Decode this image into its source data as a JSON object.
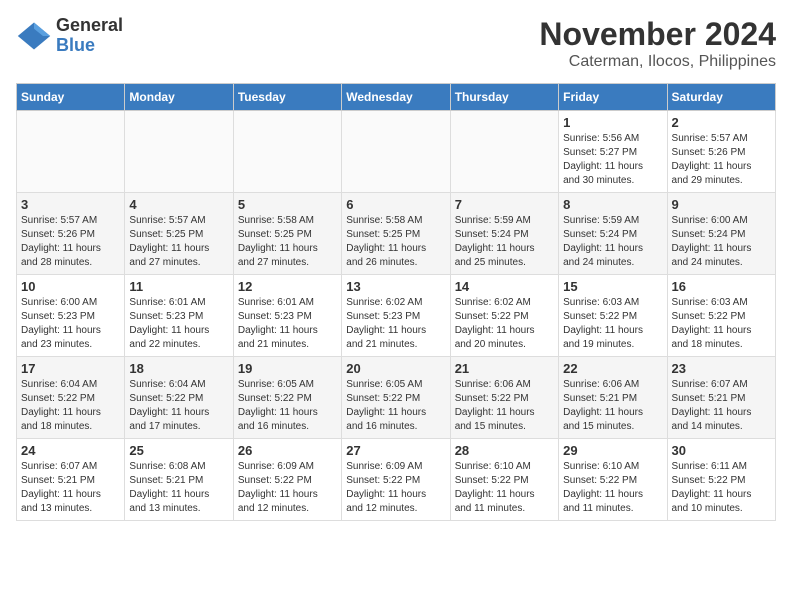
{
  "header": {
    "logo_line1": "General",
    "logo_line2": "Blue",
    "month_title": "November 2024",
    "location": "Caterman, Ilocos, Philippines"
  },
  "days_of_week": [
    "Sunday",
    "Monday",
    "Tuesday",
    "Wednesday",
    "Thursday",
    "Friday",
    "Saturday"
  ],
  "weeks": [
    [
      {
        "day": "",
        "info": ""
      },
      {
        "day": "",
        "info": ""
      },
      {
        "day": "",
        "info": ""
      },
      {
        "day": "",
        "info": ""
      },
      {
        "day": "",
        "info": ""
      },
      {
        "day": "1",
        "info": "Sunrise: 5:56 AM\nSunset: 5:27 PM\nDaylight: 11 hours\nand 30 minutes."
      },
      {
        "day": "2",
        "info": "Sunrise: 5:57 AM\nSunset: 5:26 PM\nDaylight: 11 hours\nand 29 minutes."
      }
    ],
    [
      {
        "day": "3",
        "info": "Sunrise: 5:57 AM\nSunset: 5:26 PM\nDaylight: 11 hours\nand 28 minutes."
      },
      {
        "day": "4",
        "info": "Sunrise: 5:57 AM\nSunset: 5:25 PM\nDaylight: 11 hours\nand 27 minutes."
      },
      {
        "day": "5",
        "info": "Sunrise: 5:58 AM\nSunset: 5:25 PM\nDaylight: 11 hours\nand 27 minutes."
      },
      {
        "day": "6",
        "info": "Sunrise: 5:58 AM\nSunset: 5:25 PM\nDaylight: 11 hours\nand 26 minutes."
      },
      {
        "day": "7",
        "info": "Sunrise: 5:59 AM\nSunset: 5:24 PM\nDaylight: 11 hours\nand 25 minutes."
      },
      {
        "day": "8",
        "info": "Sunrise: 5:59 AM\nSunset: 5:24 PM\nDaylight: 11 hours\nand 24 minutes."
      },
      {
        "day": "9",
        "info": "Sunrise: 6:00 AM\nSunset: 5:24 PM\nDaylight: 11 hours\nand 24 minutes."
      }
    ],
    [
      {
        "day": "10",
        "info": "Sunrise: 6:00 AM\nSunset: 5:23 PM\nDaylight: 11 hours\nand 23 minutes."
      },
      {
        "day": "11",
        "info": "Sunrise: 6:01 AM\nSunset: 5:23 PM\nDaylight: 11 hours\nand 22 minutes."
      },
      {
        "day": "12",
        "info": "Sunrise: 6:01 AM\nSunset: 5:23 PM\nDaylight: 11 hours\nand 21 minutes."
      },
      {
        "day": "13",
        "info": "Sunrise: 6:02 AM\nSunset: 5:23 PM\nDaylight: 11 hours\nand 21 minutes."
      },
      {
        "day": "14",
        "info": "Sunrise: 6:02 AM\nSunset: 5:22 PM\nDaylight: 11 hours\nand 20 minutes."
      },
      {
        "day": "15",
        "info": "Sunrise: 6:03 AM\nSunset: 5:22 PM\nDaylight: 11 hours\nand 19 minutes."
      },
      {
        "day": "16",
        "info": "Sunrise: 6:03 AM\nSunset: 5:22 PM\nDaylight: 11 hours\nand 18 minutes."
      }
    ],
    [
      {
        "day": "17",
        "info": "Sunrise: 6:04 AM\nSunset: 5:22 PM\nDaylight: 11 hours\nand 18 minutes."
      },
      {
        "day": "18",
        "info": "Sunrise: 6:04 AM\nSunset: 5:22 PM\nDaylight: 11 hours\nand 17 minutes."
      },
      {
        "day": "19",
        "info": "Sunrise: 6:05 AM\nSunset: 5:22 PM\nDaylight: 11 hours\nand 16 minutes."
      },
      {
        "day": "20",
        "info": "Sunrise: 6:05 AM\nSunset: 5:22 PM\nDaylight: 11 hours\nand 16 minutes."
      },
      {
        "day": "21",
        "info": "Sunrise: 6:06 AM\nSunset: 5:22 PM\nDaylight: 11 hours\nand 15 minutes."
      },
      {
        "day": "22",
        "info": "Sunrise: 6:06 AM\nSunset: 5:21 PM\nDaylight: 11 hours\nand 15 minutes."
      },
      {
        "day": "23",
        "info": "Sunrise: 6:07 AM\nSunset: 5:21 PM\nDaylight: 11 hours\nand 14 minutes."
      }
    ],
    [
      {
        "day": "24",
        "info": "Sunrise: 6:07 AM\nSunset: 5:21 PM\nDaylight: 11 hours\nand 13 minutes."
      },
      {
        "day": "25",
        "info": "Sunrise: 6:08 AM\nSunset: 5:21 PM\nDaylight: 11 hours\nand 13 minutes."
      },
      {
        "day": "26",
        "info": "Sunrise: 6:09 AM\nSunset: 5:22 PM\nDaylight: 11 hours\nand 12 minutes."
      },
      {
        "day": "27",
        "info": "Sunrise: 6:09 AM\nSunset: 5:22 PM\nDaylight: 11 hours\nand 12 minutes."
      },
      {
        "day": "28",
        "info": "Sunrise: 6:10 AM\nSunset: 5:22 PM\nDaylight: 11 hours\nand 11 minutes."
      },
      {
        "day": "29",
        "info": "Sunrise: 6:10 AM\nSunset: 5:22 PM\nDaylight: 11 hours\nand 11 minutes."
      },
      {
        "day": "30",
        "info": "Sunrise: 6:11 AM\nSunset: 5:22 PM\nDaylight: 11 hours\nand 10 minutes."
      }
    ]
  ]
}
